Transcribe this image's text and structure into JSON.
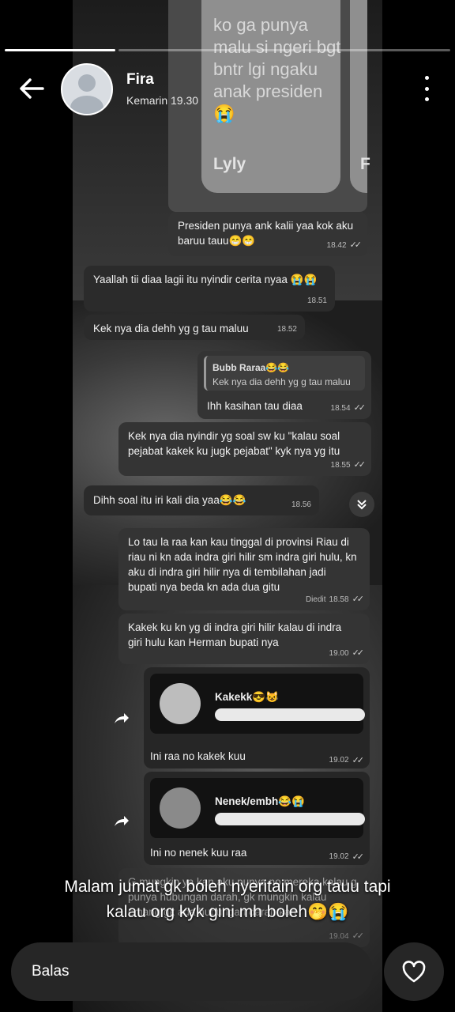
{
  "header": {
    "name": "Fira",
    "time": "Kemarin 19.30"
  },
  "story_card": {
    "text": "ko ga punya malu si ngeri bgt bntr lgi ngaku anak presiden 😭",
    "name": "Lyly",
    "next_initial": "F"
  },
  "messages": [
    {
      "text": "Presiden punya ank kalii yaa kok aku baruu tauu😁😁",
      "time": "18.42",
      "out": true
    },
    {
      "text": "Yaallah tii diaa lagii itu nyindir cerita nyaa 😭😭",
      "time": "18.51",
      "out": false
    },
    {
      "text": "Kek nya dia dehh yg g tau maluu",
      "time": "18.52",
      "out": false
    },
    {
      "quote_name": "Bubb Raraa😂😂",
      "quote_text": "Kek nya dia dehh yg g tau maluu",
      "text": "Ihh kasihan tau diaa",
      "time": "18.54",
      "out": true
    },
    {
      "text": "Kek nya dia nyindir yg soal sw ku \"kalau soal pejabat kakek ku jugk pejabat\" kyk nya yg itu",
      "time": "18.55",
      "out": true
    },
    {
      "text": "Dihh soal itu iri kali dia yaa😂😂",
      "time": "18.56",
      "out": false
    },
    {
      "text": "Lo tau la raa kan kau tinggal di provinsi Riau di riau ni kn ada indra giri hilir sm indra giri hulu, kn aku di indra giri hilir nya di tembilahan jadi bupati nya beda kn ada dua gitu",
      "time": "18.58",
      "edited": "Diedit",
      "out": true
    },
    {
      "text": "Kakek ku kn yg di indra giri hilir kalau di indra giri hulu kan Herman bupati nya",
      "time": "19.00",
      "out": true
    }
  ],
  "contacts": [
    {
      "name": "Kakekk😎😺",
      "message": "Ini raa no kakek kuu",
      "time": "19.02"
    },
    {
      "name": "Nenek/embh😂😭",
      "message": "Ini no nenek kuu raa",
      "time": "19.02"
    }
  ],
  "partial_message": {
    "text": "G mungkin ya kan aku punya no mereka kalau g punya hubungan darah, gk mungkin kalau emang gk ada hubungan darah kan",
    "time": "19.04"
  },
  "caption": {
    "line1": "Malam jumat gk boleh nyeritain org tauu tapi",
    "line2": "kalau org kyk gini mh boleh🤭😭"
  },
  "reply": {
    "placeholder": "Balas"
  },
  "icons": {
    "back": "arrow-left-icon",
    "menu": "kebab-menu-icon",
    "forward": "forward-icon",
    "scroll": "chevron-double-down-icon",
    "like": "heart-icon"
  }
}
